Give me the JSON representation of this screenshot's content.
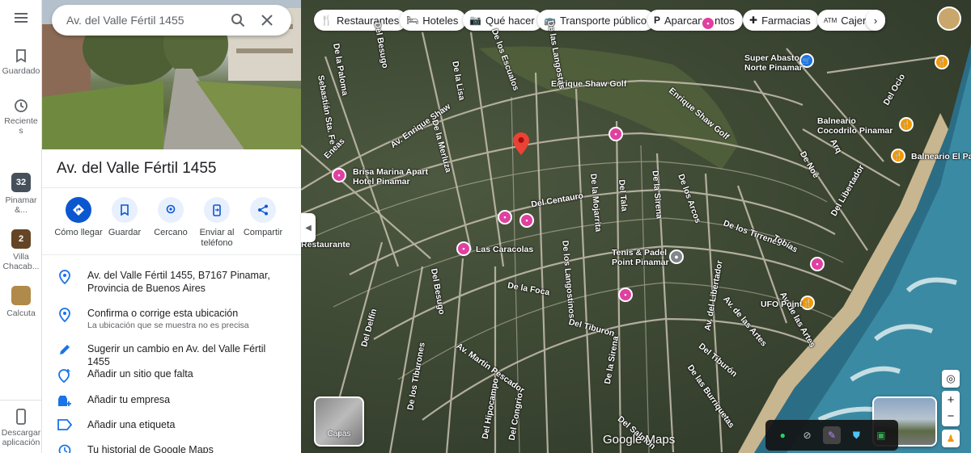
{
  "search": {
    "value": "Av. del Valle Fértil 1455",
    "search_icon": "search-icon",
    "clear_icon": "close-icon"
  },
  "rail": {
    "menu_icon": "menu-icon",
    "saved_label": "Guardado",
    "recent_label": "Reciente\ns",
    "recents": [
      {
        "label": "Pinamar\n&...",
        "count": "32",
        "color": "#6b7b8c"
      },
      {
        "label": "Villa\nChacab...",
        "count": "2",
        "color": "#9a6a3a"
      },
      {
        "label": "Calcuta",
        "count": "",
        "color": "#b08a4a"
      }
    ],
    "download_label": "Descargar\naplicación"
  },
  "place": {
    "title": "Av. del Valle Fértil 1455",
    "actions": [
      {
        "label": "Cómo llegar",
        "icon": "directions-icon"
      },
      {
        "label": "Guardar",
        "icon": "bookmark-icon"
      },
      {
        "label": "Cercano",
        "icon": "nearby-icon"
      },
      {
        "label": "Enviar al\nteléfono",
        "icon": "send-to-phone-icon"
      },
      {
        "label": "Compartir",
        "icon": "share-icon"
      }
    ],
    "address": "Av. del Valle Fértil 1455, B7167 Pinamar, Provincia de Buenos Aires",
    "confirm": "Confirma o corrige esta ubicación",
    "confirm_sub": "La ubicación que se muestra no es precisa",
    "suggest": "Sugerir un cambio en Av. del Valle Fértil 1455",
    "add_place": "Añadir un sitio que falta",
    "add_business": "Añadir tu empresa",
    "add_label": "Añadir una etiqueta",
    "history": "Tu historial de Google Maps"
  },
  "chips": [
    {
      "label": "Restaurantes",
      "icon": "restaurant-icon"
    },
    {
      "label": "Hoteles",
      "icon": "hotel-icon"
    },
    {
      "label": "Qué hacer",
      "icon": "camera-icon"
    },
    {
      "label": "Transporte público",
      "icon": "transit-icon"
    },
    {
      "label": "Aparcamientos",
      "icon": "parking-icon"
    },
    {
      "label": "Farmacias",
      "icon": "pharmacy-icon"
    },
    {
      "label": "Cajeros",
      "icon": "atm-icon"
    }
  ],
  "map": {
    "labels": {
      "enrique_shaw_golf": "Enrique Shaw Golf",
      "av_enrique_shaw": "Av. Enrique Shaw",
      "enrique_shaw_golf_road": "Enrique Shaw Golf",
      "de_la_paloma": "De la Paloma",
      "del_besugo_top": "Del Besugo",
      "de_los_escualos": "De los Escualos",
      "de_las_langostas": "De las Langostas",
      "de_la_lisa": "De la Lisa",
      "de_la_merluza": "De la Merluza",
      "sebastian_sta_fe": "Sebastián Sta. Fe",
      "eneas": "Eneas",
      "del_centauro": "Del Centauro",
      "de_la_mojarrita": "De la Mojarrita",
      "del_tala": "Del Tala",
      "de_la_sirena": "De la Sirena",
      "de_los_arcos": "De los Arcos",
      "de_los_tirrenes": "De los Tirrenes",
      "tobias": "Tobías",
      "de_la_foca": "De la Foca",
      "del_tiburon": "Del Tiburón",
      "del_tiburon2": "Del Tiburón",
      "de_los_langostinos": "De los Langostinos",
      "del_besugo": "Del Besugo",
      "del_delfin": "Del Delfín",
      "de_la_sirena2": "De la Sirena",
      "av_del_libertador": "Av. del Libertador",
      "av_de_las_artes": "Av. de las Artes",
      "av_martin_pescador": "Av. Martín Pescador",
      "del_hipocampo": "Del Hipocampo",
      "del_congrio": "Del Congrio",
      "del_salmon": "Del Salmón",
      "de_las_burriquetas": "De las Burriquetas",
      "de_los_tiburones": "De los Tiburones",
      "arq": "Arq",
      "de_noe": "De Noé",
      "del_libertador_right": "Del Libertador",
      "av_de_las_artes_right": "Av. de las Artes",
      "del_ocio": "Del Ocio"
    },
    "pois": {
      "super_abasto": "Super Abasto\nNorte Pinamar",
      "balneario_cocodrilo": "Balneario\nCocodrilo Pinamar",
      "balneario_el_pa": "Balneario El Pa",
      "brisa_marina": "Brisa Marina Apart\nHotel Pinamar",
      "las_caracolas": "Las Caracolas",
      "tenis_padel": "Tenis & Padel\nPoint Pinamar",
      "ufo_point": "UFO Point",
      "restaurante": "Restaurante"
    },
    "layers_label": "Capas",
    "brand": "Google Maps"
  }
}
